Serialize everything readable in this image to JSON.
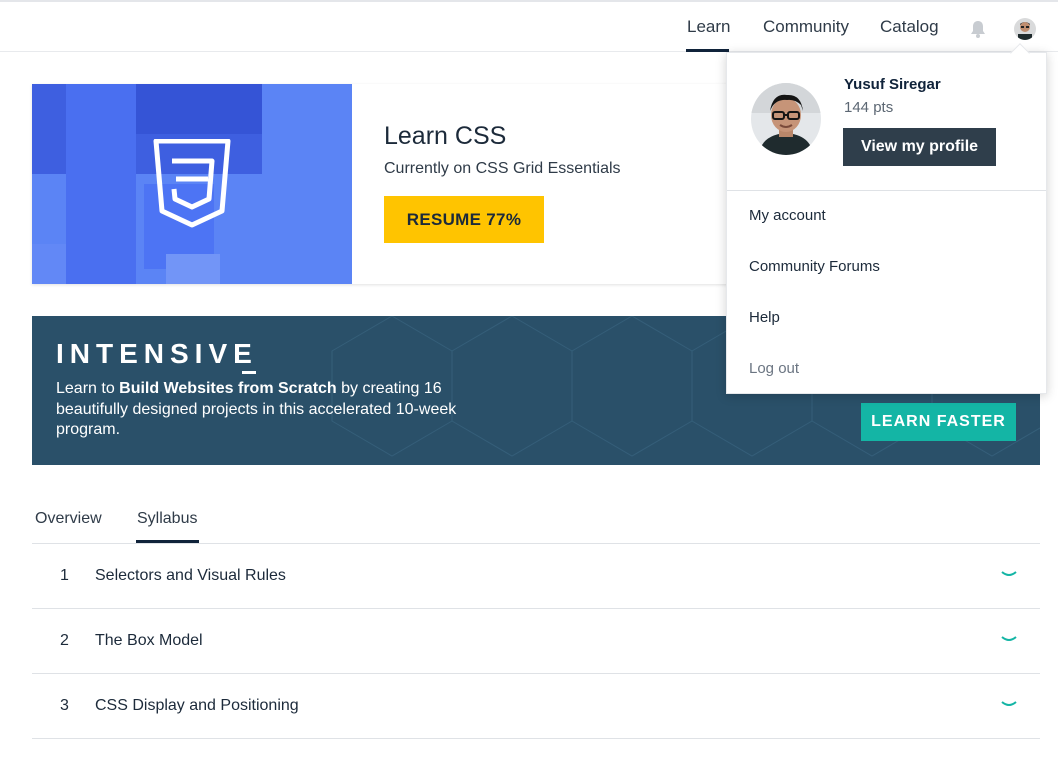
{
  "nav": {
    "learn": "Learn",
    "community": "Community",
    "catalog": "Catalog",
    "bell_icon": "bell-icon",
    "avatar_icon": "user-avatar"
  },
  "course": {
    "title": "Learn CSS",
    "subtitle": "Currently on CSS Grid Essentials",
    "resume_label": "RESUME 77%",
    "art_icon": "css3-logo",
    "accent": "#ffc400"
  },
  "intensive": {
    "title": "INTENSIVE",
    "text_pre": "Learn to ",
    "text_bold": "Build Websites from Scratch",
    "text_post": " by creating 16 beautifully designed projects in this accelerated 10-week program.",
    "button_label": "LEARN FASTER",
    "accent": "#14b5a5"
  },
  "tabs": {
    "overview": "Overview",
    "syllabus": "Syllabus"
  },
  "syllabus": [
    {
      "num": "1",
      "title": "Selectors and Visual Rules"
    },
    {
      "num": "2",
      "title": "The Box Model"
    },
    {
      "num": "3",
      "title": "CSS Display and Positioning"
    }
  ],
  "dropdown": {
    "name": "Yusuf Siregar",
    "points": "144 pts",
    "profile_button": "View my profile",
    "items": [
      "My account",
      "Community Forums",
      "Help",
      "Log out"
    ]
  }
}
